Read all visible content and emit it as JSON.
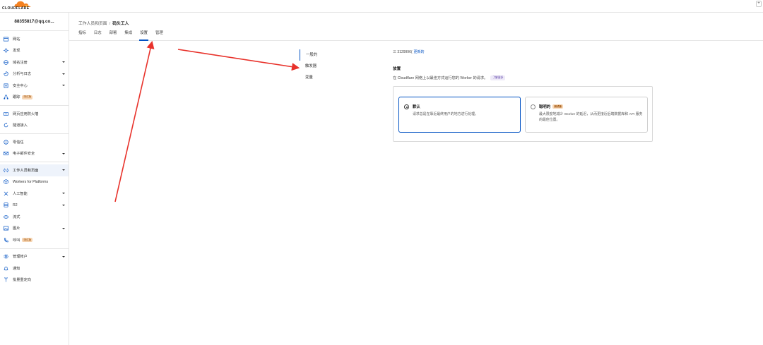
{
  "brand": {
    "logo_text": "CLOUDFLARE",
    "accent": "#f48120"
  },
  "top_right": {
    "button": "+"
  },
  "sidebar": {
    "account": "88355817@qq.co...",
    "items": [
      {
        "label": "网站",
        "icon": "browser-icon",
        "chevron": false
      },
      {
        "label": "发现",
        "icon": "sparkle-icon",
        "chevron": false
      },
      {
        "label": "域名注册",
        "icon": "globe-icon",
        "chevron": true
      },
      {
        "label": "分析与日志",
        "icon": "chart-icon",
        "chevron": true
      },
      {
        "label": "安全中心",
        "icon": "shield-icon",
        "chevron": true
      },
      {
        "label": "跟踪",
        "icon": "sitemap-icon",
        "chevron": false,
        "badge": "测试版"
      },
      {
        "divider": true
      },
      {
        "label": "网页应用防火墙",
        "icon": "firewall-icon",
        "chevron": false
      },
      {
        "label": "隧道接入",
        "icon": "loop-icon",
        "chevron": false
      },
      {
        "divider": true
      },
      {
        "label": "零信任",
        "icon": "zero-trust-icon",
        "chevron": false
      },
      {
        "label": "电子邮件安全",
        "icon": "email-icon",
        "chevron": true
      },
      {
        "divider": true
      },
      {
        "label": "工作人员和页面",
        "icon": "workers-icon",
        "chevron": true,
        "active": true
      },
      {
        "label": "Workers for Platforms",
        "icon": "cube-icon",
        "chevron": false
      },
      {
        "label": "人工智能",
        "icon": "ai-icon",
        "chevron": true
      },
      {
        "label": "R2",
        "icon": "database-icon",
        "chevron": true
      },
      {
        "label": "流式",
        "icon": "stream-icon",
        "chevron": false
      },
      {
        "label": "图片",
        "icon": "image-icon",
        "chevron": true
      },
      {
        "label": "呼叫",
        "icon": "phone-icon",
        "chevron": false,
        "badge": "测试版"
      },
      {
        "divider": true
      },
      {
        "label": "管理帐户",
        "icon": "gear-icon",
        "chevron": true
      },
      {
        "label": "通知",
        "icon": "bell-icon",
        "chevron": false
      },
      {
        "label": "批量重定向",
        "icon": "redirect-icon",
        "chevron": false
      }
    ]
  },
  "header": {
    "breadcrumb_parent": "工作人员和页面",
    "breadcrumb_sep": "/",
    "breadcrumb_current": "码头工人",
    "tabs": [
      "指标",
      "日志",
      "部署",
      "集成",
      "设置",
      "管理"
    ],
    "active_tab": 4
  },
  "settings": {
    "subnav": [
      "一般的",
      "触发器",
      "变量"
    ],
    "active_subnav": 0,
    "link_prefix": "三 3129996(",
    "link_text": "更新的",
    "section_title": "放置",
    "section_desc": "在 Cloudflare 网络上以最佳方式运行您的 Worker 的请求。",
    "learn_tag": "了解更多",
    "options": [
      {
        "title": "默认",
        "desc": "请求总是在靠近最终用户的地方进行处理。",
        "selected": true
      },
      {
        "title": "聪明的",
        "badge": "测试版",
        "desc": "最大限度地减少 Worker 的延迟，从而更接近后端数据库和 API 服务的最佳位置。",
        "selected": false
      }
    ]
  },
  "annotation": {
    "arrow_color": "#e8322b"
  }
}
